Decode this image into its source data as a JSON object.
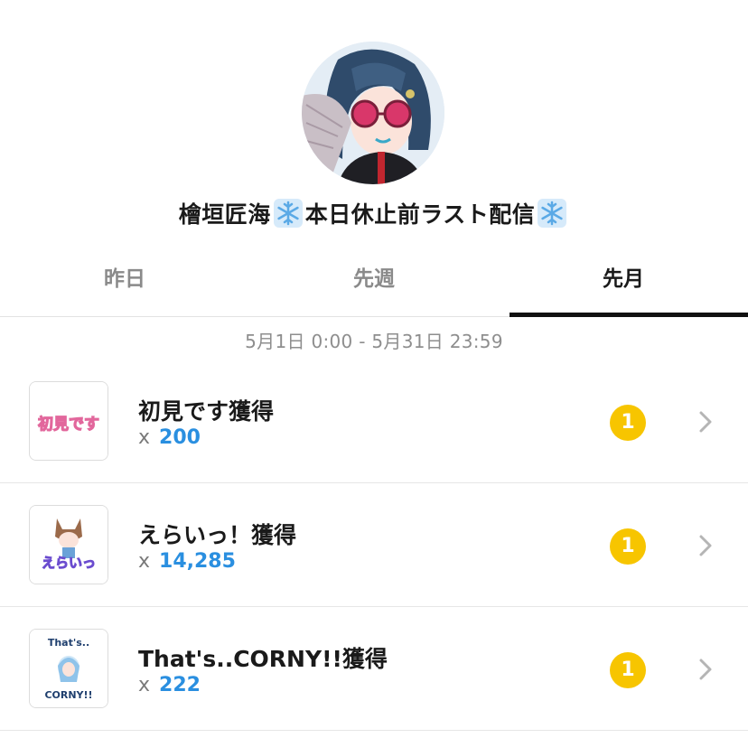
{
  "profile": {
    "name_part1": "檜垣匠海",
    "name_part2": "本日休止前ラスト配信",
    "snowflake_icon": "snowflake-icon"
  },
  "tabs": [
    {
      "label": "昨日",
      "active": false
    },
    {
      "label": "先週",
      "active": false
    },
    {
      "label": "先月",
      "active": true
    }
  ],
  "date_range": "5月1日 0:00 - 5月31日 23:59",
  "items": [
    {
      "name": "初見です獲得",
      "count_prefix": "x",
      "count": "200",
      "badge": "1",
      "sticker_text": "初見です"
    },
    {
      "name": "えらいっ！獲得",
      "count_prefix": "x",
      "count": "14,285",
      "badge": "1",
      "sticker_text": "えらいっ"
    },
    {
      "name": "That's..CORNY!!獲得",
      "count_prefix": "x",
      "count": "222",
      "badge": "1",
      "sticker_text_top": "That's..",
      "sticker_text_bottom": "CORNY!!"
    }
  ],
  "colors": {
    "accent_blue": "#2a8fe0",
    "coin_yellow": "#f7c500",
    "tab_underline": "#111111"
  }
}
